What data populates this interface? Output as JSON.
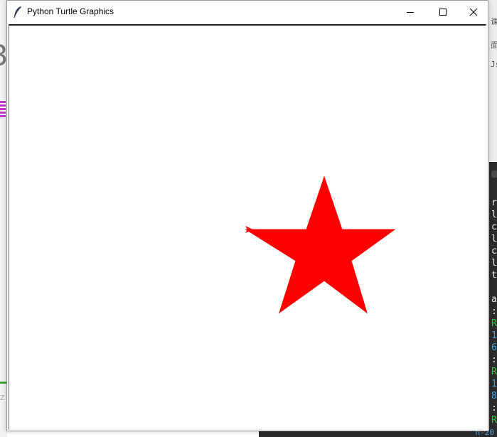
{
  "window": {
    "title": "Python Turtle Graphics",
    "controls": {
      "minimize": "minimize",
      "maximize": "maximize",
      "close": "close"
    }
  },
  "drawing": {
    "shape": "star",
    "fill_color": "#ff0000",
    "turtle_color": "#ff0000",
    "canvas_background": "#ffffff"
  },
  "background": {
    "left_fragment": "3",
    "left_faint_fragment": "z",
    "right_top_fragments": [
      "课",
      "面",
      "Js"
    ],
    "right_terminal_lines": [
      {
        "text": "r",
        "color": "#e8e8e8"
      },
      {
        "text": "l",
        "color": "#e8e8e8"
      },
      {
        "text": "c",
        "color": "#e8e8e8"
      },
      {
        "text": "l",
        "color": "#e8e8e8"
      },
      {
        "text": "c",
        "color": "#e8e8e8"
      },
      {
        "text": "l",
        "color": "#e8e8e8"
      },
      {
        "text": "t",
        "color": "#e8e8e8"
      },
      {
        "text": "",
        "color": "#e8e8e8"
      },
      {
        "text": "a",
        "color": "#e8e8e8"
      },
      {
        "text": ":",
        "color": "#e8e8e8"
      },
      {
        "text": "R",
        "color": "#3fc24a"
      },
      {
        "text": "1",
        "color": "#3fa0e0"
      },
      {
        "text": "6",
        "color": "#3fa0e0"
      },
      {
        "text": ":",
        "color": "#e8e8e8"
      },
      {
        "text": "R",
        "color": "#3fc24a"
      },
      {
        "text": "1",
        "color": "#3fa0e0"
      },
      {
        "text": "8",
        "color": "#3fa0e0"
      },
      {
        "text": ":",
        "color": "#e8e8e8"
      },
      {
        "text": "R",
        "color": "#3fc24a"
      }
    ],
    "taskbar_text": "n-20"
  }
}
